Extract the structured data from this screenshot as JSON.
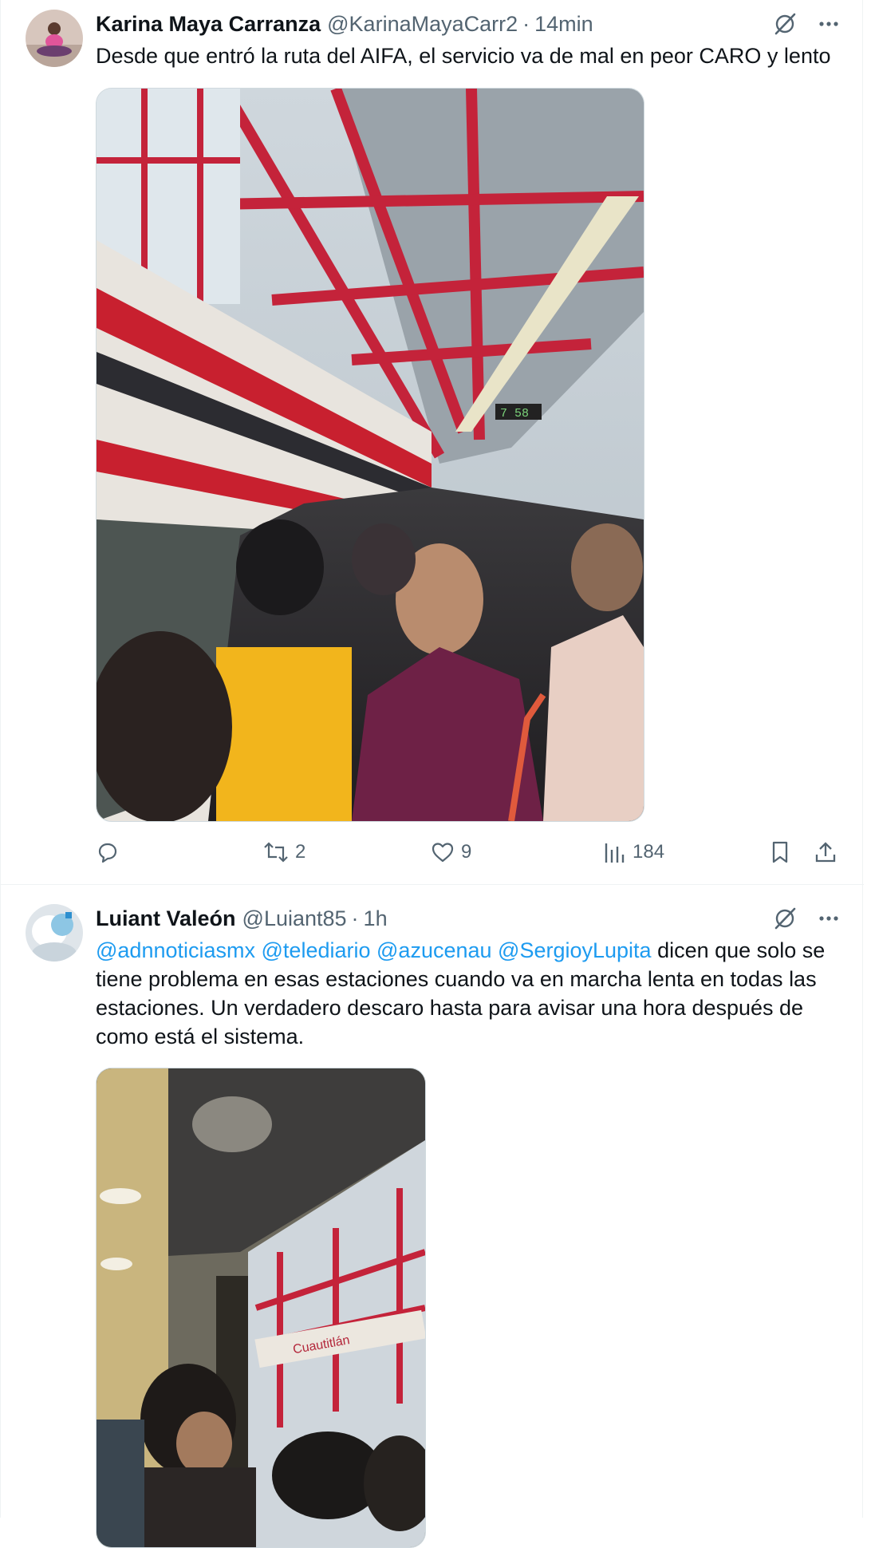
{
  "tweets": [
    {
      "name": "Karina Maya Carranza",
      "handle": "@KarinaMayaCarr2",
      "separator": "·",
      "time": "14min",
      "text": "Desde que entró la ruta del AIFA, el servicio va de mal en peor CARO y lento",
      "stats": {
        "replies": "",
        "reposts": "2",
        "likes": "9",
        "views": "184"
      }
    },
    {
      "name": "Luiant Valeón",
      "handle": "@Luiant85",
      "separator": "·",
      "time": "1h",
      "mentions": [
        "@adnnoticiasmx",
        "@telediario",
        "@azucenau",
        "@SergioyLupita"
      ],
      "text_after_mentions": " dicen que solo se tiene problema en esas estaciones cuando va en marcha lenta en todas las estaciones. Un verdadero descaro hasta para avisar una hora después de como está el sistema.",
      "sign_text": "Cuautitlán",
      "clock_text": "7 58"
    }
  ],
  "icons": {
    "grok": "grok-slash-icon",
    "more": "more-dots-icon",
    "reply": "reply-bubble-icon",
    "repost": "repost-arrows-icon",
    "like": "heart-icon",
    "views": "views-bars-icon",
    "bookmark": "bookmark-icon",
    "share": "share-upload-icon"
  },
  "colors": {
    "text": "#0f1419",
    "secondary": "#536471",
    "link": "#1d9bf0",
    "border": "#eff3f4"
  }
}
